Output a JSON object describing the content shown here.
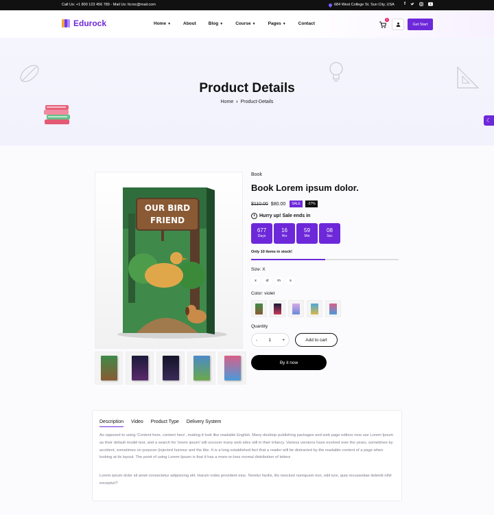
{
  "topbar": {
    "contact": "Call Us: +1 800 123 456 789 - Mail Us: ltcroc@mail.com",
    "address": "684 West College St. Sun City, USA",
    "socials": [
      "f",
      "t",
      "ig",
      "yt"
    ]
  },
  "header": {
    "logo": "Edurock",
    "nav": [
      {
        "label": "Home",
        "dropdown": true
      },
      {
        "label": "About",
        "dropdown": false
      },
      {
        "label": "Blog",
        "dropdown": true
      },
      {
        "label": "Course",
        "dropdown": true
      },
      {
        "label": "Pages",
        "dropdown": true
      },
      {
        "label": "Contact",
        "dropdown": false
      }
    ],
    "cart_count": "0",
    "cta": "Get Start"
  },
  "hero": {
    "title": "Product Details",
    "crumb_home": "Home",
    "crumb_current": "Product-Details"
  },
  "product": {
    "category": "Book",
    "title": "Book Lorem ipsum dolor.",
    "old_price": "$110.00",
    "new_price": "$80.00",
    "sale_badge": "SALE",
    "discount_badge": "-27%",
    "hurry": "Hurry up! Sale ends in",
    "countdown": [
      {
        "value": "677",
        "label": "Days"
      },
      {
        "value": "16",
        "label": "Hrs"
      },
      {
        "value": "59",
        "label": "Min"
      },
      {
        "value": "08",
        "label": "Sec"
      }
    ],
    "stock_text": "Only 10 items in stock!",
    "stock_fraction": 0.5,
    "size_label": "Size: X",
    "sizes": [
      "x",
      "xl",
      "m",
      "s"
    ],
    "color_label": "Color: violet",
    "quantity_label": "Quantity",
    "quantity": "1",
    "minus": "-",
    "plus": "+",
    "add_to_cart": "Add to cart",
    "buy_now": "By it now",
    "cover_title_1": "OUR BIRD",
    "cover_title_2": "FRIEND"
  },
  "tabs": {
    "items": [
      "Description",
      "Video",
      "Product Type",
      "Delivery System"
    ],
    "p1": "As opposed to using 'Content here, content here', making it look like readable English. Many desktop publishing packages and web page editors now use Lorem Ipsum as their default model text, and a search for 'lorem ipsum' will uncover many web sites still in their infancy. Various versions have evolved over the years, sometimes by accident, sometimes on purpose (injected humour and the like. It is a long established fact that a reader will be distracted by the readable content of a page when looking at its layout. The point of using Lorem Ipsum is that it has a more-or-less normal distribution of letters",
    "p2": "Lorem ipsum dolor sit amet consectetur adipisicing elit. Harum nobis provident eius. Tenetur facilis, illo nesciunt numquam non, odit iure, quia recusandae deleniti nihil excepturi?"
  },
  "colors": {
    "accent": "#6d28d9",
    "dark": "#111111"
  }
}
